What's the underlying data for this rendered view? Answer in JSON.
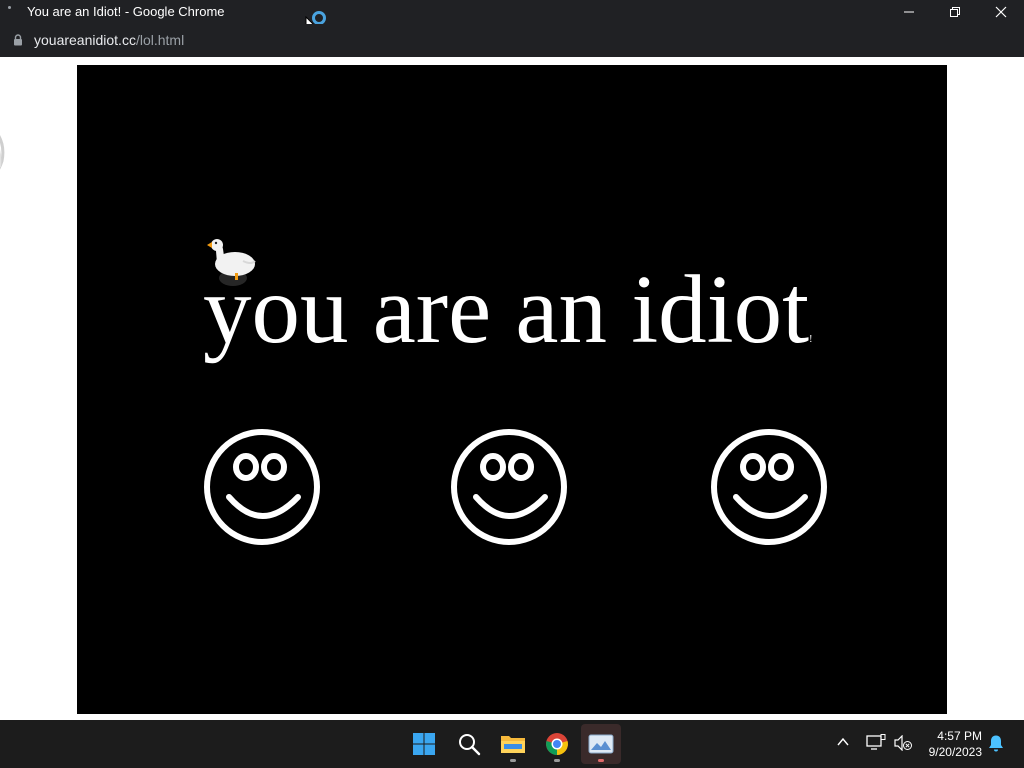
{
  "window": {
    "title": "You are an Idiot! - Google Chrome",
    "controls": [
      "minimize",
      "restore",
      "close"
    ]
  },
  "address_bar": {
    "url_host": "youareanidiot.cc",
    "url_path": "/lol.html"
  },
  "page": {
    "headline": "you are an idiot",
    "headline_trailing_mark": "!",
    "background_color": "#000000",
    "text_color": "#ffffff",
    "smiley_count": 3
  },
  "taskbar": {
    "apps": [
      "start-icon",
      "search-icon",
      "file-explorer-icon",
      "chrome-icon",
      "image-viewer-icon"
    ],
    "tray": [
      "chevron-up-icon",
      "network-icon",
      "volume-muted-icon"
    ],
    "time": "4:57 PM",
    "date": "9/20/2023"
  }
}
